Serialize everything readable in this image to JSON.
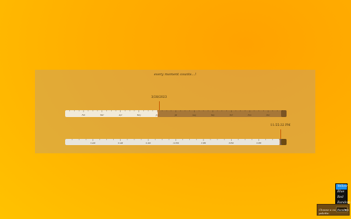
{
  "tagline": "every moment counts…!",
  "rulers": [
    {
      "id": "year",
      "marker_text": "3/28/2023",
      "progress": 0.42,
      "tick_labels": [
        "Feb",
        "Mar",
        "Apr",
        "May",
        "Jun",
        "Jul",
        "Aug",
        "Sep",
        "Oct",
        "Nov",
        "Dec"
      ],
      "colors": {
        "filled": "#f1ead9",
        "remaining": "#a77738",
        "track_end": "#7b5524",
        "marker": "#c85a00"
      }
    },
    {
      "id": "day",
      "marker_text": "11:55:32 PM",
      "progress": 0.97,
      "tick_labels": [
        "3 AM",
        "6 AM",
        "9 AM",
        "12 PM",
        "3 PM",
        "6 PM",
        "9 PM"
      ],
      "colors": {
        "filled": "#e8e5dc",
        "remaining": "#6b6b6b",
        "track_end": "#6e4a12",
        "marker": "#c85a00"
      }
    }
  ],
  "palette": {
    "items": [
      "Yellow",
      "Blue",
      "Red",
      "Random"
    ],
    "selected": "Yellow"
  },
  "theme": {
    "label": "Choose a color palette:",
    "selected": "Random"
  }
}
